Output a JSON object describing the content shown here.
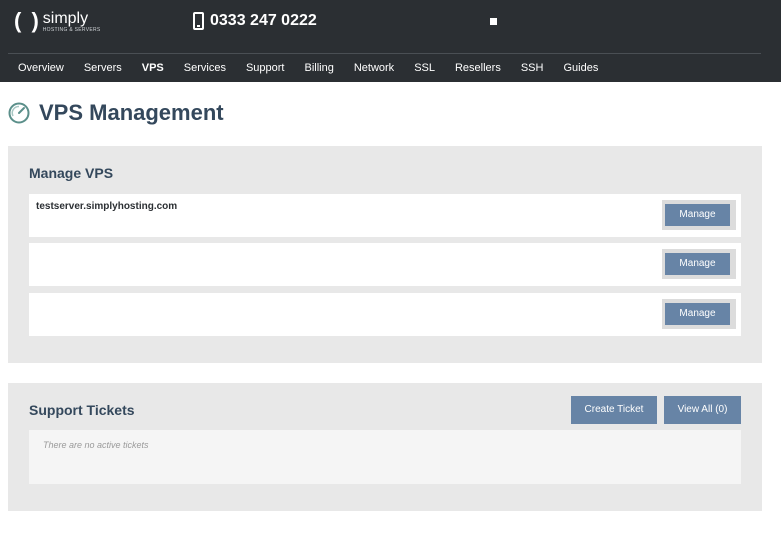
{
  "header": {
    "logo": {
      "mark": "( )",
      "name": "simply",
      "tagline": "HOSTING & SERVERS"
    },
    "phone": "0333 247 0222"
  },
  "nav": {
    "items": [
      {
        "label": "Overview"
      },
      {
        "label": "Servers"
      },
      {
        "label": "VPS",
        "active": true
      },
      {
        "label": "Services"
      },
      {
        "label": "Support"
      },
      {
        "label": "Billing"
      },
      {
        "label": "Network"
      },
      {
        "label": "SSL"
      },
      {
        "label": "Resellers"
      },
      {
        "label": "SSH"
      },
      {
        "label": "Guides"
      }
    ]
  },
  "page": {
    "title": "VPS Management",
    "icon": "gauge-icon"
  },
  "manage_vps": {
    "title": "Manage VPS",
    "rows": [
      {
        "name": "testserver.simplyhosting.com",
        "button": "Manage"
      },
      {
        "name": "",
        "button": "Manage"
      },
      {
        "name": "",
        "button": "Manage"
      }
    ]
  },
  "support_tickets": {
    "title": "Support Tickets",
    "create_label": "Create Ticket",
    "view_all_label": "View All (0)",
    "empty_text": "There are no active tickets"
  },
  "colors": {
    "topbar": "#2b2f33",
    "heading": "#34485c",
    "button": "#6784a6",
    "panel": "#e8e8e8"
  }
}
